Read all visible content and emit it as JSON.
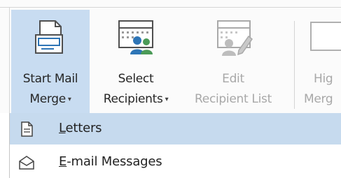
{
  "ribbon": {
    "buttons": [
      {
        "line1": "Start Mail",
        "line2": "Merge",
        "has_dropdown": true,
        "state": "active"
      },
      {
        "line1": "Select",
        "line2": "Recipients",
        "has_dropdown": true,
        "state": "normal"
      },
      {
        "line1": "Edit",
        "line2": "Recipient List",
        "has_dropdown": false,
        "state": "disabled"
      },
      {
        "line1": "Hig",
        "line2": "Merg",
        "has_dropdown": false,
        "state": "disabled"
      }
    ],
    "dropdown_caret": "▾"
  },
  "menu": {
    "items": [
      {
        "accel": "L",
        "rest": "etters",
        "icon": "document-icon",
        "state": "hover"
      },
      {
        "accel": "E",
        "rest": "-mail Messages",
        "icon": "envelope-icon",
        "state": "normal"
      }
    ]
  },
  "colors": {
    "active_button_bg": "#c8dcf1",
    "menu_hover_bg": "#c6daee",
    "icon_blue": "#2e75b6",
    "icon_green": "#4a9a57",
    "disabled_text": "#a8a8a8"
  }
}
